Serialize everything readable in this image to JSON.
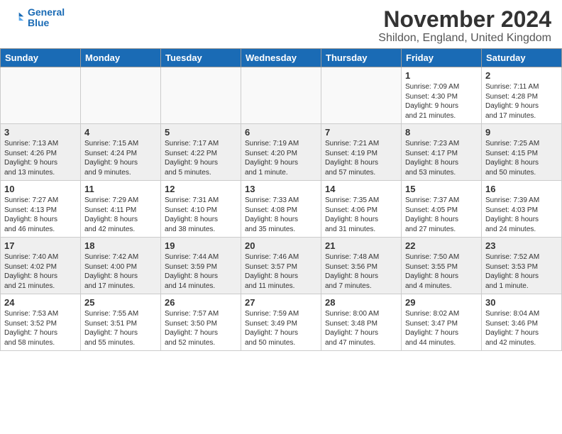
{
  "header": {
    "logo_line1": "General",
    "logo_line2": "Blue",
    "month_title": "November 2024",
    "location": "Shildon, England, United Kingdom"
  },
  "days_of_week": [
    "Sunday",
    "Monday",
    "Tuesday",
    "Wednesday",
    "Thursday",
    "Friday",
    "Saturday"
  ],
  "weeks": [
    {
      "days": [
        {
          "num": "",
          "info": "",
          "empty": true
        },
        {
          "num": "",
          "info": "",
          "empty": true
        },
        {
          "num": "",
          "info": "",
          "empty": true
        },
        {
          "num": "",
          "info": "",
          "empty": true
        },
        {
          "num": "",
          "info": "",
          "empty": true
        },
        {
          "num": "1",
          "info": "Sunrise: 7:09 AM\nSunset: 4:30 PM\nDaylight: 9 hours\nand 21 minutes."
        },
        {
          "num": "2",
          "info": "Sunrise: 7:11 AM\nSunset: 4:28 PM\nDaylight: 9 hours\nand 17 minutes."
        }
      ]
    },
    {
      "shade": true,
      "days": [
        {
          "num": "3",
          "info": "Sunrise: 7:13 AM\nSunset: 4:26 PM\nDaylight: 9 hours\nand 13 minutes."
        },
        {
          "num": "4",
          "info": "Sunrise: 7:15 AM\nSunset: 4:24 PM\nDaylight: 9 hours\nand 9 minutes."
        },
        {
          "num": "5",
          "info": "Sunrise: 7:17 AM\nSunset: 4:22 PM\nDaylight: 9 hours\nand 5 minutes."
        },
        {
          "num": "6",
          "info": "Sunrise: 7:19 AM\nSunset: 4:20 PM\nDaylight: 9 hours\nand 1 minute."
        },
        {
          "num": "7",
          "info": "Sunrise: 7:21 AM\nSunset: 4:19 PM\nDaylight: 8 hours\nand 57 minutes."
        },
        {
          "num": "8",
          "info": "Sunrise: 7:23 AM\nSunset: 4:17 PM\nDaylight: 8 hours\nand 53 minutes."
        },
        {
          "num": "9",
          "info": "Sunrise: 7:25 AM\nSunset: 4:15 PM\nDaylight: 8 hours\nand 50 minutes."
        }
      ]
    },
    {
      "shade": false,
      "days": [
        {
          "num": "10",
          "info": "Sunrise: 7:27 AM\nSunset: 4:13 PM\nDaylight: 8 hours\nand 46 minutes."
        },
        {
          "num": "11",
          "info": "Sunrise: 7:29 AM\nSunset: 4:11 PM\nDaylight: 8 hours\nand 42 minutes."
        },
        {
          "num": "12",
          "info": "Sunrise: 7:31 AM\nSunset: 4:10 PM\nDaylight: 8 hours\nand 38 minutes."
        },
        {
          "num": "13",
          "info": "Sunrise: 7:33 AM\nSunset: 4:08 PM\nDaylight: 8 hours\nand 35 minutes."
        },
        {
          "num": "14",
          "info": "Sunrise: 7:35 AM\nSunset: 4:06 PM\nDaylight: 8 hours\nand 31 minutes."
        },
        {
          "num": "15",
          "info": "Sunrise: 7:37 AM\nSunset: 4:05 PM\nDaylight: 8 hours\nand 27 minutes."
        },
        {
          "num": "16",
          "info": "Sunrise: 7:39 AM\nSunset: 4:03 PM\nDaylight: 8 hours\nand 24 minutes."
        }
      ]
    },
    {
      "shade": true,
      "days": [
        {
          "num": "17",
          "info": "Sunrise: 7:40 AM\nSunset: 4:02 PM\nDaylight: 8 hours\nand 21 minutes."
        },
        {
          "num": "18",
          "info": "Sunrise: 7:42 AM\nSunset: 4:00 PM\nDaylight: 8 hours\nand 17 minutes."
        },
        {
          "num": "19",
          "info": "Sunrise: 7:44 AM\nSunset: 3:59 PM\nDaylight: 8 hours\nand 14 minutes."
        },
        {
          "num": "20",
          "info": "Sunrise: 7:46 AM\nSunset: 3:57 PM\nDaylight: 8 hours\nand 11 minutes."
        },
        {
          "num": "21",
          "info": "Sunrise: 7:48 AM\nSunset: 3:56 PM\nDaylight: 8 hours\nand 7 minutes."
        },
        {
          "num": "22",
          "info": "Sunrise: 7:50 AM\nSunset: 3:55 PM\nDaylight: 8 hours\nand 4 minutes."
        },
        {
          "num": "23",
          "info": "Sunrise: 7:52 AM\nSunset: 3:53 PM\nDaylight: 8 hours\nand 1 minute."
        }
      ]
    },
    {
      "shade": false,
      "days": [
        {
          "num": "24",
          "info": "Sunrise: 7:53 AM\nSunset: 3:52 PM\nDaylight: 7 hours\nand 58 minutes."
        },
        {
          "num": "25",
          "info": "Sunrise: 7:55 AM\nSunset: 3:51 PM\nDaylight: 7 hours\nand 55 minutes."
        },
        {
          "num": "26",
          "info": "Sunrise: 7:57 AM\nSunset: 3:50 PM\nDaylight: 7 hours\nand 52 minutes."
        },
        {
          "num": "27",
          "info": "Sunrise: 7:59 AM\nSunset: 3:49 PM\nDaylight: 7 hours\nand 50 minutes."
        },
        {
          "num": "28",
          "info": "Sunrise: 8:00 AM\nSunset: 3:48 PM\nDaylight: 7 hours\nand 47 minutes."
        },
        {
          "num": "29",
          "info": "Sunrise: 8:02 AM\nSunset: 3:47 PM\nDaylight: 7 hours\nand 44 minutes."
        },
        {
          "num": "30",
          "info": "Sunrise: 8:04 AM\nSunset: 3:46 PM\nDaylight: 7 hours\nand 42 minutes."
        }
      ]
    }
  ]
}
